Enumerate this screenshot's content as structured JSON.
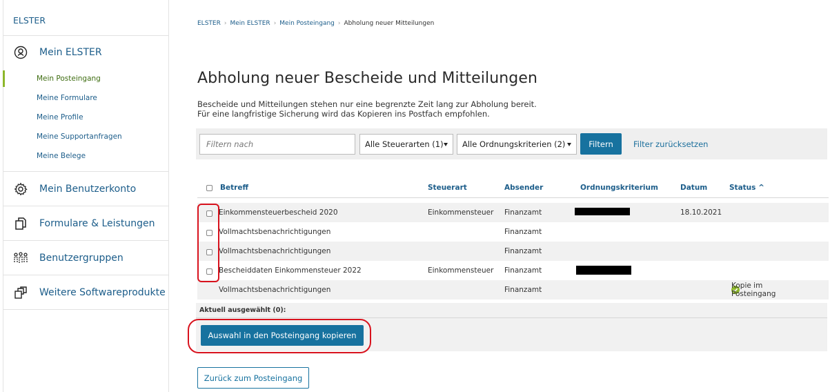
{
  "sidebar": {
    "brand": "ELSTER",
    "mein_elster": {
      "label": "Mein ELSTER",
      "items": [
        "Mein Posteingang",
        "Meine Formulare",
        "Meine Profile",
        "Meine Supportanfragen",
        "Meine Belege"
      ]
    },
    "sections": [
      "Mein Benutzerkonto",
      "Formulare & Leistungen",
      "Benutzergruppen",
      "Weitere Softwareprodukte"
    ]
  },
  "breadcrumb": [
    "ELSTER",
    "Mein ELSTER",
    "Mein Posteingang",
    "Abholung neuer Mitteilungen"
  ],
  "page": {
    "title": "Abholung neuer Bescheide und Mitteilungen",
    "intro_line1": "Bescheide und Mitteilungen stehen nur eine begrenzte Zeit lang zur Abholung bereit.",
    "intro_line2": "Für eine langfristige Sicherung wird das Kopieren ins Postfach empfohlen."
  },
  "filter": {
    "placeholder": "Filtern nach",
    "steuerarten": "Alle Steuerarten (1)",
    "ordnungskriterien": "Alle Ordnungskriterien (2)",
    "filter_button": "Filtern",
    "reset_link": "Filter zurücksetzen"
  },
  "table": {
    "headers": {
      "betreff": "Betreff",
      "steuerart": "Steuerart",
      "absender": "Absender",
      "ordnungskriterium": "Ordnungskriterium",
      "datum": "Datum",
      "status": "Status ^"
    },
    "rows": [
      {
        "betreff": "Einkommensteuerbescheid 2020",
        "steuerart": "Einkommensteuer",
        "absender": "Finanzamt",
        "datum": "18.10.2021",
        "status": ""
      },
      {
        "betreff": "Vollmachtsbenachrichtigungen",
        "steuerart": "",
        "absender": "Finanzamt",
        "datum": "",
        "status": ""
      },
      {
        "betreff": "Vollmachtsbenachrichtigungen",
        "steuerart": "",
        "absender": "Finanzamt",
        "datum": "",
        "status": ""
      },
      {
        "betreff": "Bescheiddaten Einkommensteuer 2022",
        "steuerart": "Einkommensteuer",
        "absender": "Finanzamt",
        "datum": "",
        "status": ""
      },
      {
        "betreff": "Vollmachtsbenachrichtigungen",
        "steuerart": "",
        "absender": "Finanzamt",
        "datum": "",
        "status": "Kopie im Posteingang"
      }
    ]
  },
  "selection": {
    "label": "Aktuell ausgewählt (0):",
    "copy_button": "Auswahl in den Posteingang kopieren"
  },
  "back_button": "Zurück zum Posteingang",
  "colors": {
    "primary": "#17729f",
    "link": "#1c5d8a",
    "accent_green": "#8db72a",
    "annotation_red": "#d8121d"
  }
}
